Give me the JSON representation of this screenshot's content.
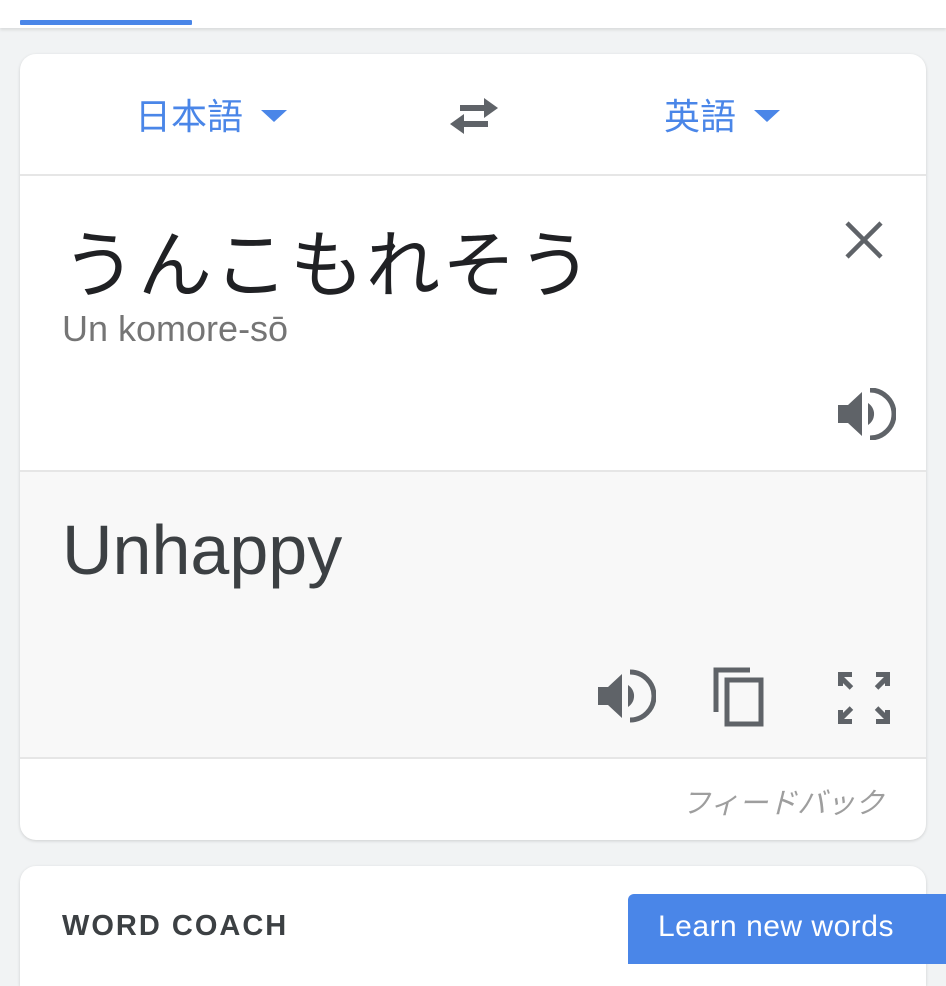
{
  "header": {
    "active_tab_color": "#4a86e8"
  },
  "languages": {
    "source": "日本語",
    "target": "英語",
    "swap_icon": "swap-horiz-icon"
  },
  "source_panel": {
    "text": "うんこもれそう",
    "transliteration": "Un komore-sō",
    "clear_icon": "close-icon",
    "speaker_icon": "volume-icon"
  },
  "result_panel": {
    "text": "Unhappy",
    "speaker_icon": "volume-icon",
    "copy_icon": "copy-icon",
    "fullscreen_icon": "fullscreen-icon"
  },
  "feedback": "フィードバック",
  "word_coach": {
    "title": "WORD COACH",
    "button": "Learn new words"
  },
  "colors": {
    "accent": "#4a86e8",
    "text_primary": "#202124",
    "text_secondary": "#757575",
    "icon": "#5f6368"
  }
}
